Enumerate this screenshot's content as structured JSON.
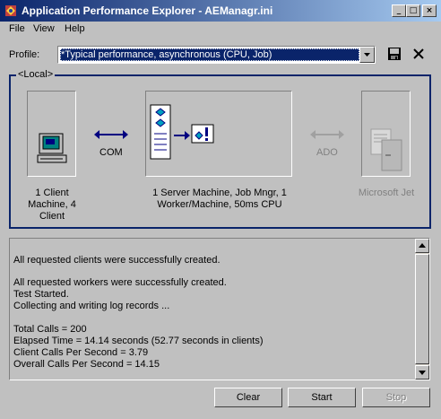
{
  "window": {
    "title": "Application Performance Explorer - AEManagr.ini",
    "minimize_glyph": "_",
    "maximize_glyph": "□",
    "close_glyph": "×"
  },
  "menu": {
    "file": "File",
    "view": "View",
    "help": "Help"
  },
  "profile": {
    "label": "Profile:",
    "selected": "*Typical performance, asynchronous (CPU, Job)"
  },
  "toolbar_icons": {
    "save": "save-icon",
    "delete": "delete-icon"
  },
  "topology": {
    "group_label": "<Local>",
    "client": {
      "caption_line1": "1 Client",
      "caption_line2": "Machine, 4",
      "caption_line3": "Client"
    },
    "link_com": "COM",
    "server": {
      "caption_line1": "1 Server Machine, Job Mngr, 1",
      "caption_line2": "Worker/Machine, 50ms CPU"
    },
    "link_ado": "ADO",
    "database": {
      "caption": "Microsoft Jet"
    }
  },
  "log": {
    "lines": [
      "All requested clients were successfully created.",
      "All requested workers were successfully created.",
      "Test Started.",
      "Collecting and writing log records ...",
      "Total Calls = 200",
      "Elapsed Time = 14.14 seconds (52.77 seconds in clients)",
      "Client Calls Per Second = 3.79",
      "Overall Calls Per Second = 14.15"
    ]
  },
  "buttons": {
    "clear": "Clear",
    "start": "Start",
    "stop": "Stop"
  },
  "colors": {
    "title_bar": "#0a246a",
    "selection": "#0a246a",
    "group_border": "#0a246a",
    "arrow_active": "#000080",
    "arrow_disabled": "#a0a0a0"
  }
}
